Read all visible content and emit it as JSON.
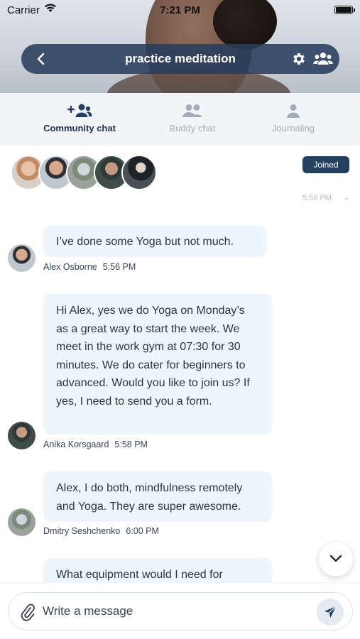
{
  "status_bar": {
    "carrier": "Carrier",
    "time": "7:21 PM"
  },
  "header": {
    "title": "practice meditation",
    "icons": [
      "back-chevron-icon",
      "gear-icon",
      "group-icon"
    ],
    "pill_color": "#283e5c"
  },
  "tabs": [
    {
      "label": "Community chat",
      "active": true,
      "icon": "add-group-icon"
    },
    {
      "label": "Buddy chat",
      "active": false,
      "icon": "buddy-icon"
    },
    {
      "label": "Journaling",
      "active": false,
      "icon": "person-icon"
    }
  ],
  "members": {
    "joined_label": "Joined",
    "peek_time": "5:56 PM"
  },
  "messages": [
    {
      "text": "I’ve done some Yoga but not much.",
      "author": "Alex Osborne",
      "time": "5:56 PM"
    },
    {
      "text": "Hi Alex, yes we do Yoga on Monday’s as a great way to start the week. We meet in the work gym at 07:30 for 30 minutes. We do cater for beginners to advanced. Would you like to join us? If yes, I need to send you a form.",
      "author": "Anika Korsgaard",
      "time": "5:58 PM"
    },
    {
      "text": "Alex, I do both, mindfulness remotely and Yoga. They are super awesome.",
      "author": "Dmitry Seshchenko",
      "time": "6:00 PM"
    },
    {
      "text": "What equipment would I need for",
      "author": "",
      "time": ""
    }
  ],
  "composer": {
    "placeholder": "Write a message"
  },
  "colors": {
    "accent": "#25405f",
    "bubble": "#eef6fd",
    "tab_bg": "#f2f4f7"
  }
}
